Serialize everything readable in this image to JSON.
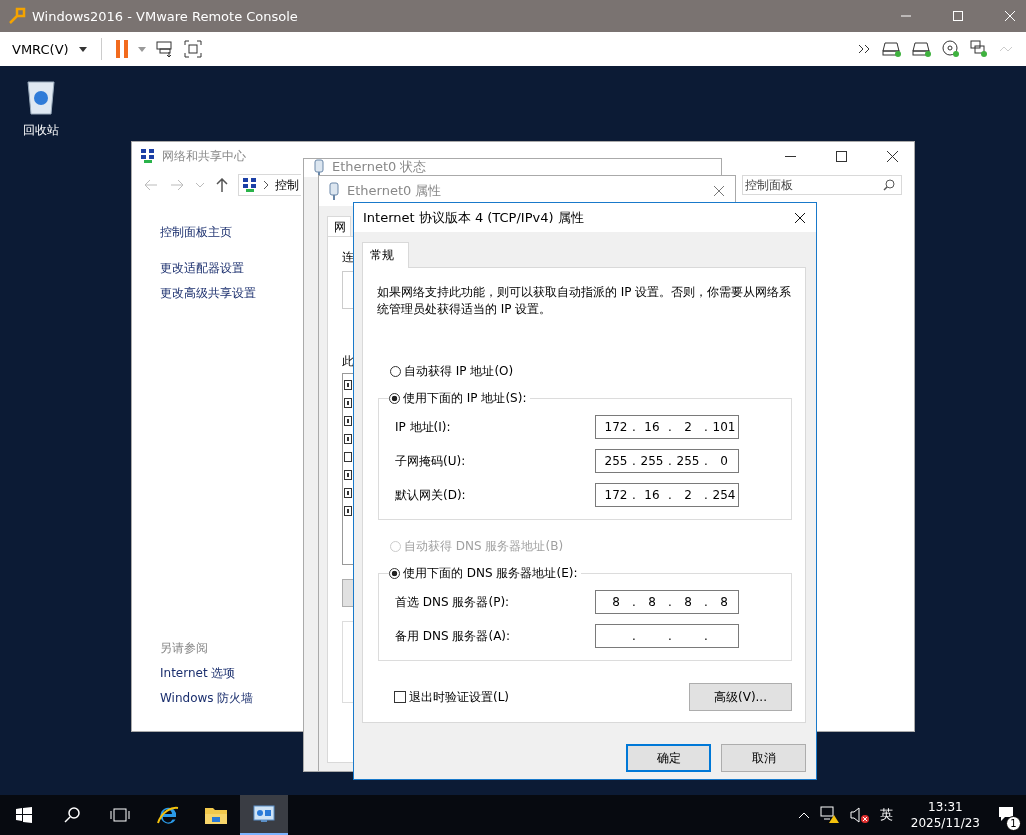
{
  "window": {
    "title": "Windows2016 - VMware Remote Console"
  },
  "toolbar": {
    "menu": "VMRC(V)"
  },
  "desktop_icons": [
    {
      "label": "回收站"
    }
  ],
  "network_center": {
    "title": "网络和共享中心",
    "address": "控制",
    "search_placeholder": "控制面板",
    "sidebar_links": [
      "控制面板主页",
      "更改适配器设置",
      "更改高级共享设置"
    ],
    "see_also_heading": "另请参阅",
    "see_also_links": [
      "Internet 选项",
      "Windows 防火墙"
    ]
  },
  "status_window": {
    "title": "Ethernet0 状态"
  },
  "properties_window": {
    "title": "Ethernet0 属性",
    "tab": "网",
    "label_1": "连",
    "label_2": "此",
    "components": [
      {
        "checked": true
      },
      {
        "checked": true
      },
      {
        "checked": true
      },
      {
        "checked": true
      },
      {
        "checked": false
      },
      {
        "checked": true
      },
      {
        "checked": true
      },
      {
        "checked": true
      }
    ]
  },
  "ipv4_dialog": {
    "title": "Internet 协议版本 4 (TCP/IPv4) 属性",
    "tabs": [
      {
        "label": "常规",
        "selected": true
      }
    ],
    "description": "如果网络支持此功能，则可以获取自动指派的 IP 设置。否则，你需要从网络系统管理员处获得适当的 IP 设置。",
    "separator": ".",
    "ip_options": [
      {
        "label": "自动获得 IP 地址(O)",
        "selected": false,
        "disabled": false
      },
      {
        "label": "使用下面的 IP 地址(S):",
        "selected": true,
        "disabled": false
      }
    ],
    "ip_fields": [
      {
        "label": "IP 地址(I):",
        "octets": [
          "172",
          "16",
          "2",
          "101"
        ]
      },
      {
        "label": "子网掩码(U):",
        "octets": [
          "255",
          "255",
          "255",
          "0"
        ]
      },
      {
        "label": "默认网关(D):",
        "octets": [
          "172",
          "16",
          "2",
          "254"
        ]
      }
    ],
    "dns_options": [
      {
        "label": "自动获得 DNS 服务器地址(B)",
        "selected": false,
        "disabled": true
      },
      {
        "label": "使用下面的 DNS 服务器地址(E):",
        "selected": true,
        "disabled": false
      }
    ],
    "dns_fields": [
      {
        "label": "首选 DNS 服务器(P):",
        "octets": [
          "8",
          "8",
          "8",
          "8"
        ]
      },
      {
        "label": "备用 DNS 服务器(A):"
      }
    ],
    "validate_on_exit": {
      "label": "退出时验证设置(L)",
      "checked": false
    },
    "advanced_button": "高级(V)...",
    "ok_button": "确定",
    "cancel_button": "取消"
  },
  "taskbar": {
    "apps": [
      {
        "kind": "ie",
        "selected": false
      },
      {
        "kind": "explorer",
        "selected": false
      },
      {
        "kind": "console",
        "selected": true
      }
    ],
    "ime": "英",
    "time": "13:31",
    "date": "2025/11/23",
    "notifications": "1"
  }
}
